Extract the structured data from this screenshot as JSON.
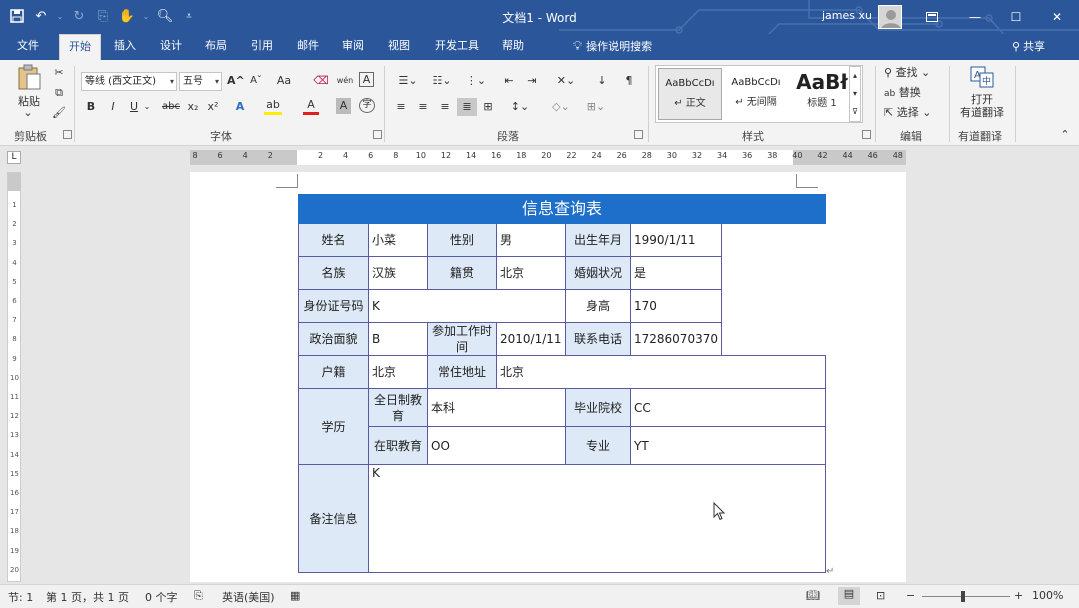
{
  "window": {
    "doc_title": "文档1  -  Word",
    "user_name": "james xu"
  },
  "tabs": [
    {
      "label": "文件"
    },
    {
      "label": "开始"
    },
    {
      "label": "插入"
    },
    {
      "label": "设计"
    },
    {
      "label": "布局"
    },
    {
      "label": "引用"
    },
    {
      "label": "邮件"
    },
    {
      "label": "审阅"
    },
    {
      "label": "视图"
    },
    {
      "label": "开发工具"
    },
    {
      "label": "帮助"
    }
  ],
  "tell_me": "操作说明搜索",
  "share_label": "共享",
  "ribbon": {
    "clipboard": {
      "paste_label": "粘贴",
      "group_label": "剪贴板"
    },
    "font": {
      "font_name": "等线 (西文正文)",
      "font_size": "五号",
      "group_label": "字体",
      "bold": "B",
      "italic": "I",
      "underline": "U",
      "strike": "abc",
      "subscript": "x₂",
      "superscript": "x²",
      "grow": "A^",
      "shrink": "Aˇ",
      "case": "Aa",
      "phonetic": "wén",
      "border_char": "A",
      "effects": "A",
      "highlight": "ab",
      "font_color": "A",
      "shading": "A",
      "enclose": "字"
    },
    "paragraph": {
      "group_label": "段落"
    },
    "styles": {
      "group_label": "样式",
      "items": [
        {
          "sample": "AaBbCcDı",
          "name": "↵ 正文"
        },
        {
          "sample": "AaBbCcDı",
          "name": "↵ 无间隔"
        },
        {
          "sample": "AaBł",
          "name": "标题 1"
        }
      ]
    },
    "editing": {
      "find": "查找",
      "replace": "替换",
      "select": "选择",
      "group_label": "编辑"
    },
    "translate": {
      "open_label": "打开",
      "label2": "有道翻译",
      "group_label": "有道翻译"
    }
  },
  "ruler": {
    "corner": "L",
    "h_numbers": [
      "8",
      "6",
      "4",
      "2",
      "",
      "2",
      "4",
      "6",
      "8",
      "10",
      "12",
      "14",
      "16",
      "18",
      "20",
      "22",
      "24",
      "26",
      "28",
      "30",
      "32",
      "34",
      "36",
      "38",
      "40",
      "42",
      "44",
      "46",
      "48"
    ],
    "v_numbers": [
      "1",
      "2",
      "3",
      "4",
      "5",
      "6",
      "7",
      "8",
      "9",
      "10",
      "11",
      "12",
      "13",
      "14",
      "15",
      "16",
      "17",
      "18",
      "19",
      "20"
    ]
  },
  "table": {
    "title": "信息查询表",
    "name_label": "姓名",
    "name_value": "小菜",
    "gender_label": "性别",
    "gender_value": "男",
    "birth_label": "出生年月",
    "birth_value": "1990/1/11",
    "ethnic_label": "名族",
    "ethnic_value": "汉族",
    "origin_label": "籍贯",
    "origin_value": "北京",
    "marital_label": "婚姻状况",
    "marital_value": "是",
    "id_label": "身份证号码",
    "id_value": "K",
    "height_label": "身高",
    "height_value": "170",
    "political_label": "政治面貌",
    "political_value": "B",
    "workdate_label": "参加工作时间",
    "workdate_value": "2010/1/11",
    "phone_label": "联系电话",
    "phone_value": "17286070370",
    "hukou_label": "户籍",
    "hukou_value": "北京",
    "address_label": "常住地址",
    "address_value": "北京",
    "education_label": "学历",
    "fulltime_label": "全日制教育",
    "fulltime_value": "本科",
    "school_label": "毕业院校",
    "school_value": "CC",
    "parttime_label": "在职教育",
    "parttime_value": "OO",
    "major_label": "专业",
    "major_value": "YT",
    "remark_label": "备注信息",
    "remark_value": "K"
  },
  "status": {
    "section": "节: 1",
    "page": "第 1 页，共 1 页",
    "words": "0 个字",
    "language": "英语(美国)",
    "zoom": "100%",
    "zoom_out": "−",
    "zoom_in": "+"
  },
  "colors": {
    "title_bar": "#2b579a",
    "table_header": "#1e6fc9",
    "label_fill": "#dde9f6",
    "table_border": "#5a5aa0"
  }
}
